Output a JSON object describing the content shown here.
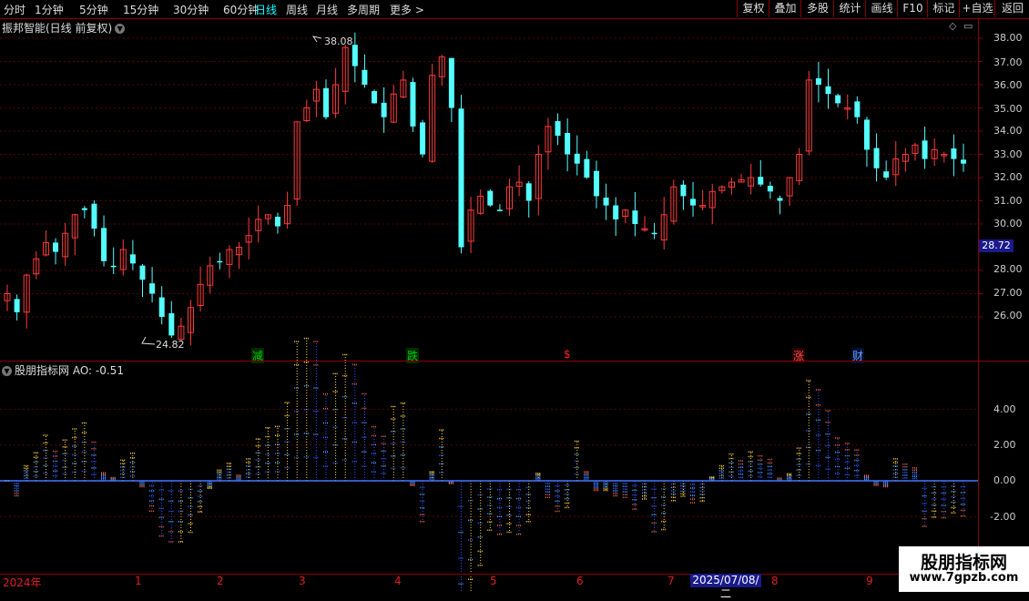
{
  "toolbar": {
    "periods": [
      "分时",
      "1分钟",
      "5分钟",
      "15分钟",
      "30分钟",
      "60分钟",
      "日线",
      "周线",
      "月线",
      "多周期",
      "更多 >"
    ],
    "active_period": "日线",
    "right_buttons": [
      "复权",
      "叠加",
      "多股",
      "统计",
      "画线",
      "F10",
      "标记",
      "+自选",
      "返回"
    ]
  },
  "chart": {
    "title": "振邦智能(日线 前复权)",
    "high_label": "38.08",
    "low_label": "24.82",
    "current_price": "28.72",
    "y_ticks": [
      "38.00",
      "37.00",
      "36.00",
      "35.00",
      "34.00",
      "33.00",
      "32.00",
      "31.00",
      "30.00",
      "28.00",
      "27.00",
      "26.00"
    ],
    "event_tags": [
      {
        "text": "减",
        "color": "#00cc00",
        "bg": "#003300"
      },
      {
        "text": "跌",
        "color": "#00cc00",
        "bg": "#003300"
      },
      {
        "text": "$",
        "color": "#ff2020",
        "bg": "#000000"
      },
      {
        "text": "涨",
        "color": "#ff4040",
        "bg": "#330000"
      },
      {
        "text": "财",
        "color": "#5599ff",
        "bg": "#001133"
      }
    ]
  },
  "indicator": {
    "title": "股朋指标网 AO: -0.51",
    "y_ticks": [
      "4.00",
      "2.00",
      "0.00",
      "-2.00"
    ]
  },
  "date_axis": {
    "labels": [
      "2024年",
      "1",
      "2",
      "3",
      "4",
      "5",
      "6",
      "7",
      "8",
      "9"
    ],
    "highlight": "2025/07/08/二"
  },
  "watermark": {
    "line1": "股朋指标网",
    "line2": "www.7gpzb.com"
  },
  "colors": {
    "up": "#ff3b3b",
    "down": "#54ffff",
    "axis": "#8b0000",
    "grid": "#5a0000"
  },
  "chart_data": {
    "type": "candlestick",
    "ylim": [
      24.82,
      38.08
    ],
    "close_series_approx": [
      27.0,
      26.2,
      27.8,
      28.5,
      29.2,
      28.8,
      29.6,
      30.4,
      30.6,
      29.8,
      28.4,
      28.2,
      28.9,
      28.3,
      27.6,
      27.0,
      26.0,
      25.2,
      25.6,
      26.4,
      27.4,
      28.2,
      28.4,
      28.9,
      29.0,
      29.5,
      30.2,
      30.4,
      29.9,
      30.8,
      34.4,
      35.0,
      35.8,
      34.6,
      36.0,
      37.6,
      36.8,
      36.0,
      35.2,
      34.6,
      35.6,
      36.2,
      34.2,
      33.0,
      36.4,
      37.2,
      35.0,
      29.0,
      30.6,
      31.2,
      30.8,
      30.6,
      31.6,
      31.8,
      31.0,
      33.0,
      34.2,
      33.8,
      33.0,
      32.6,
      32.0,
      31.2,
      30.8,
      30.2,
      30.6,
      30.0,
      29.8,
      29.6,
      30.4,
      31.6,
      31.2,
      30.8,
      30.8,
      31.4,
      31.6,
      31.8,
      31.9,
      32.0,
      31.7,
      31.4,
      31.0,
      32.0,
      33.0,
      36.2,
      36.0,
      35.6,
      35.2,
      35.0,
      34.6,
      33.2,
      32.4,
      32.0,
      32.8,
      33.0,
      33.4,
      32.8,
      33.2,
      33.0,
      32.8,
      32.6
    ]
  }
}
